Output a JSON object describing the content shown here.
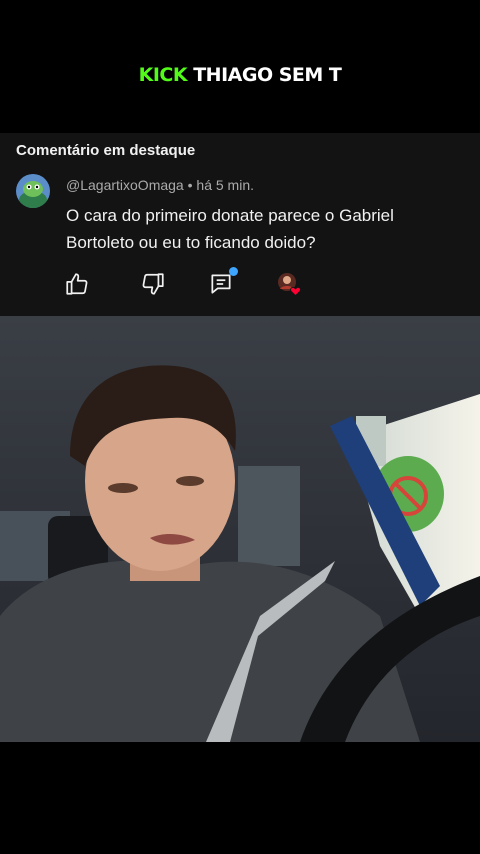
{
  "header": {
    "brand": "KICK",
    "channel": "THIAGO SEM T"
  },
  "comment": {
    "section_title": "Comentário em destaque",
    "author": "@LagartixoOmaga",
    "separator": "•",
    "time": "há 5 min.",
    "text": "O cara do primeiro donate parece o Gabriel Bortoleto ou eu to ficando doido?"
  },
  "actions": {
    "icons": [
      "thumbs-up-icon",
      "thumbs-down-icon",
      "reply-icon",
      "creator-heart-icon"
    ],
    "reply_notification_color": "#3ea6ff",
    "heart_color": "#ff0033"
  },
  "colors": {
    "kick_green": "#53fc18",
    "card_bg": "#131313"
  }
}
